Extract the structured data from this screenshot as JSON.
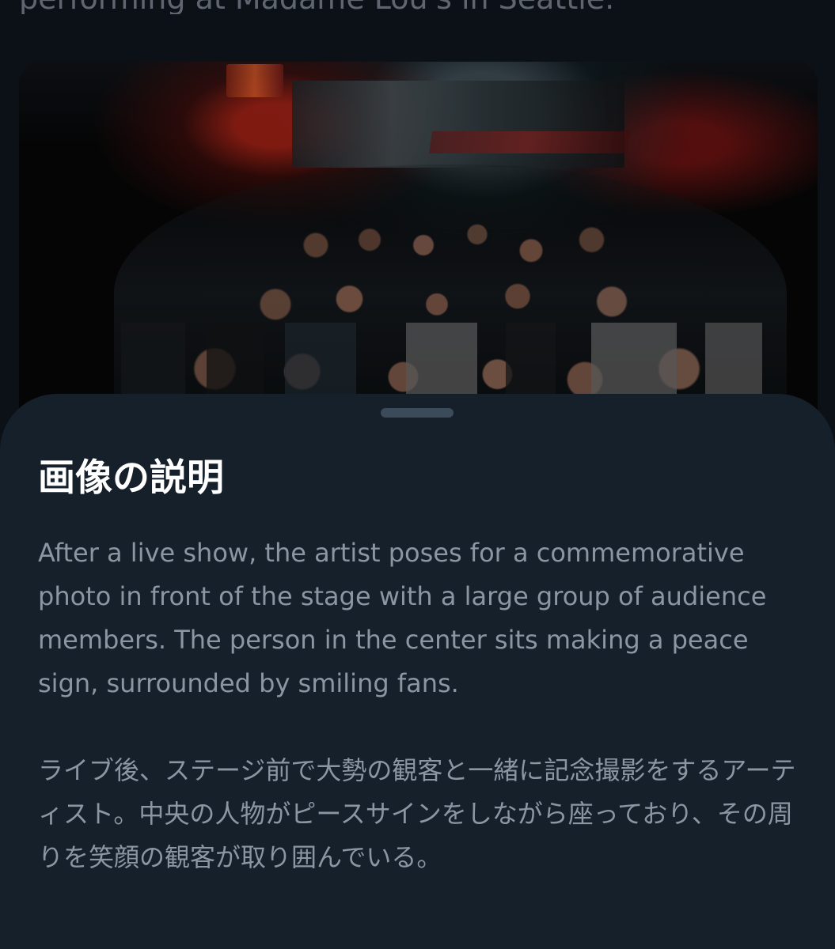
{
  "post": {
    "partial_text": "performing at Madame Lou's in Seattle."
  },
  "image": {
    "alt": "After a live show, the artist poses for a commemorative photo in front of the stage with a large group of audience members. The person in the center sits making a peace sign, surrounded by smiling fans."
  },
  "description_sheet": {
    "title": "画像の説明",
    "body": "After a live show, the artist poses for a commemorative photo in front of the stage with a large group of audience members. The person in the center sits making a peace sign, surrounded by smiling fans.\n\nライブ後、ステージ前で大勢の観客と一緒に記念撮影をするアーティスト。中央の人物がピースサインをしながら座っており、その周りを笑顔の観客が取り囲んでいる。"
  },
  "colors": {
    "background": "#0c1117",
    "sheet_background": "#16202a",
    "title_text": "#ffffff",
    "body_text": "#8c96a3",
    "handle": "#3c4b5a"
  }
}
